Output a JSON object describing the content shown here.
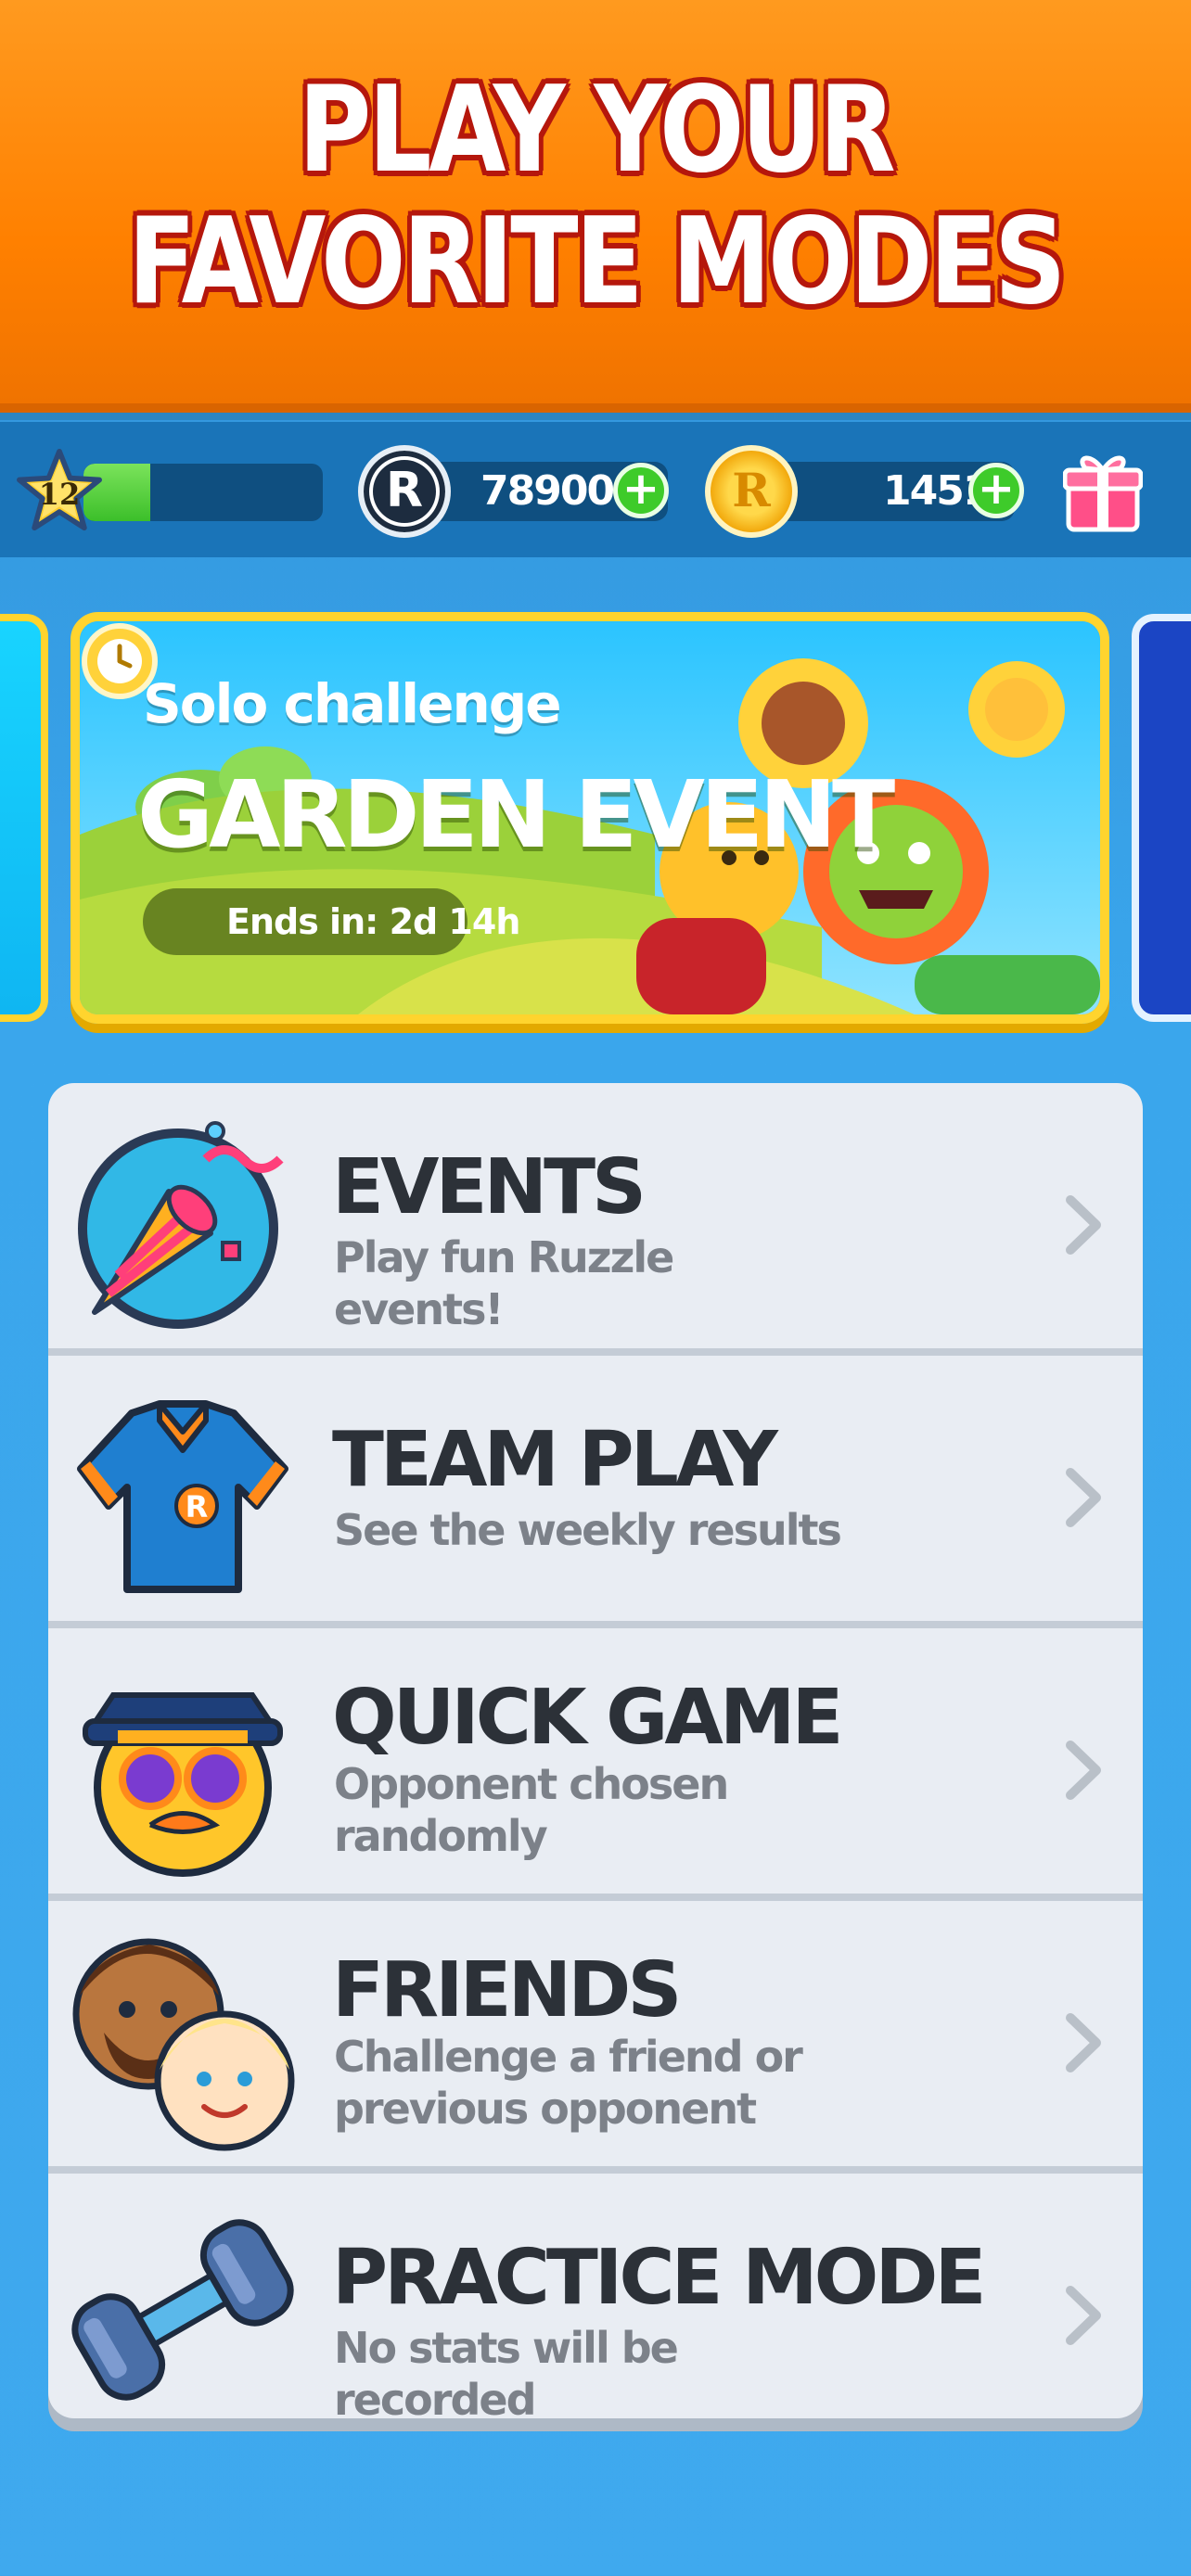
{
  "banner": {
    "line1": "PLAY YOUR",
    "line2": "FAVORITE MODES"
  },
  "status_bar": {
    "level": "12",
    "xp_progress": 0.28,
    "rubies": "78900",
    "coins": "1451"
  },
  "event_card": {
    "subtitle": "Solo challenge",
    "title": "GARDEN EVENT",
    "timer": "Ends in: 2d 14h"
  },
  "modes": [
    {
      "title": "EVENTS",
      "description": "Play fun Ruzzle events!"
    },
    {
      "title": "TEAM PLAY",
      "description": "See the weekly results"
    },
    {
      "title": "QUICK GAME",
      "description": "Opponent chosen randomly"
    },
    {
      "title": "FRIENDS",
      "description": "Challenge a friend or previous opponent"
    },
    {
      "title": "PRACTICE MODE",
      "description": "No stats will be recorded"
    }
  ],
  "colors": {
    "banner_orange": "#ff8000",
    "background_blue": "#3aa6ec",
    "card_border_yellow": "#ffd42e",
    "plus_green": "#3ecb2a"
  },
  "icons": [
    "star-icon",
    "ruby-coin-icon",
    "gold-coin-icon",
    "gift-icon",
    "party-popper-icon",
    "jersey-icon",
    "hipster-face-icon",
    "friends-faces-icon",
    "dumbbell-icon",
    "chevron-right-icon",
    "clock-icon"
  ]
}
